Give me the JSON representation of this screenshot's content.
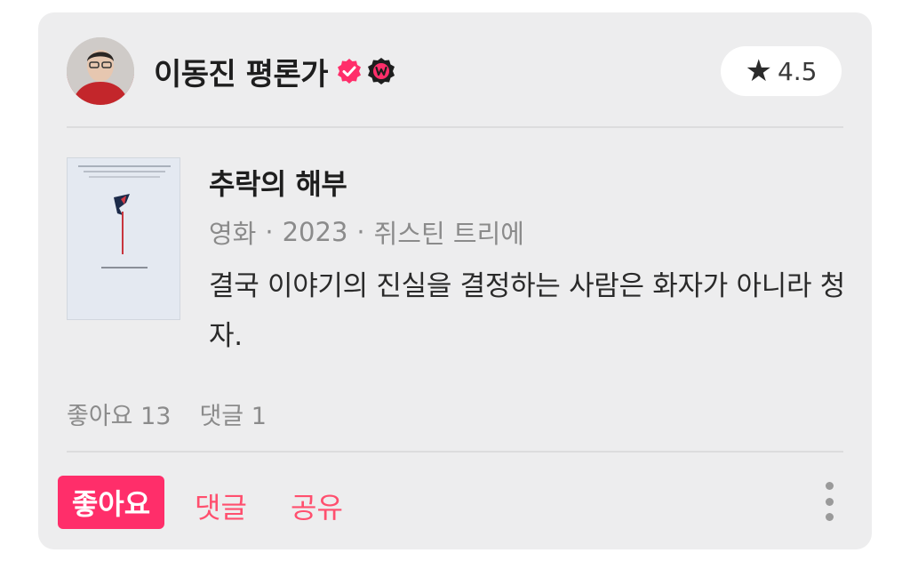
{
  "review": {
    "author": {
      "name": "이동진 평론가",
      "verified_icon": "verified-check-icon",
      "badge_icon": "watcha-w-badge-icon"
    },
    "rating": {
      "icon": "star-icon",
      "value": "4.5"
    },
    "movie": {
      "title": "추락의 해부",
      "type": "영화",
      "year": "2023",
      "director": "쥐스틴 트리에",
      "separator": "·",
      "poster_text": "추락의\n해부"
    },
    "text": "결국 이야기의 진실을 결정하는 사람은 화자가 아니라 청자.",
    "stats": {
      "likes": "좋아요 13",
      "comments": "댓글 1"
    },
    "actions": {
      "like": "좋아요",
      "comment": "댓글",
      "share": "공유",
      "more_icon": "more-vertical-icon"
    }
  },
  "colors": {
    "accent": "#ff2e6a",
    "action_text": "#ff4f6e",
    "card_bg": "#ededee",
    "muted": "#8b8b8b"
  }
}
